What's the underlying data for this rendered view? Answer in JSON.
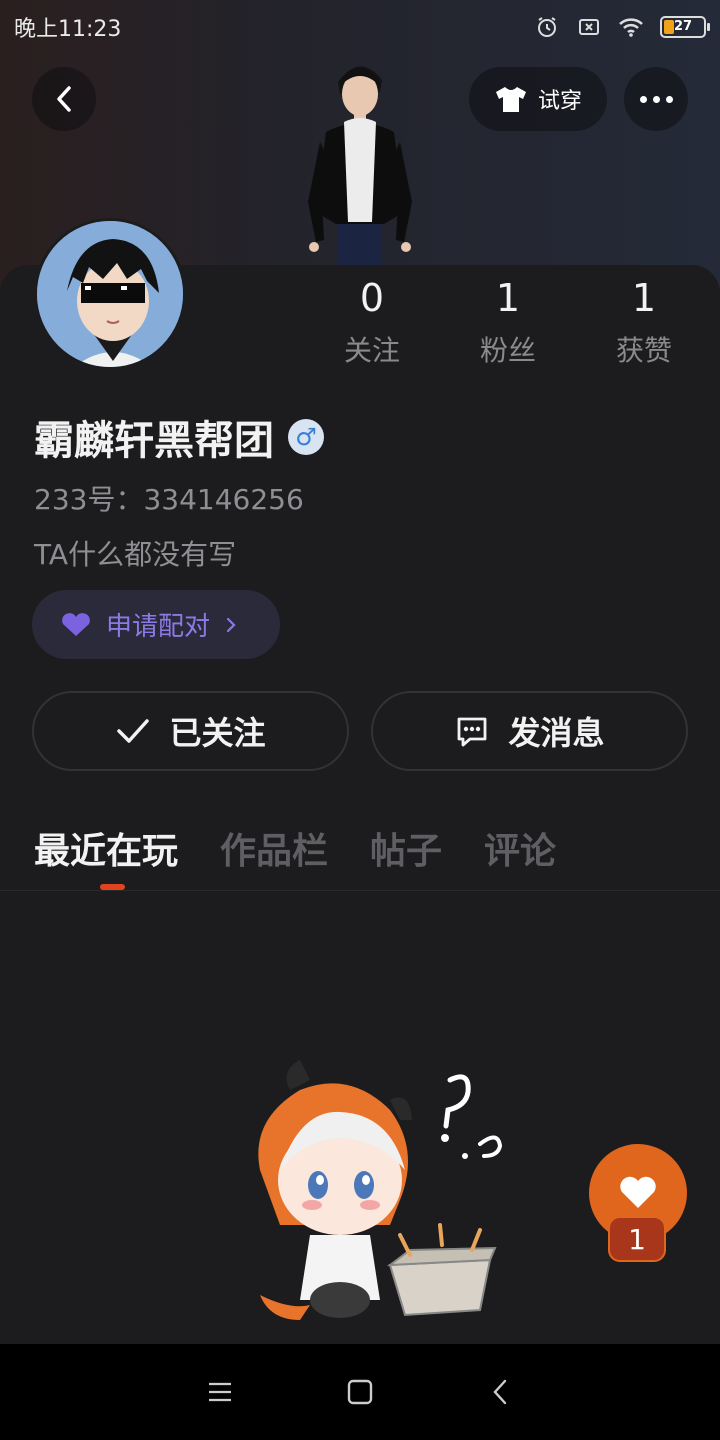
{
  "status_bar": {
    "time": "晚上11:23",
    "battery": "27"
  },
  "header": {
    "tryon_label": "试穿"
  },
  "profile": {
    "name": "霸麟轩黑帮团",
    "gender_symbol": "♂",
    "uid": "233号：334146256",
    "bio": "TA什么都没有写",
    "pair_label": "申请配对"
  },
  "stats": [
    {
      "value": "0",
      "label": "关注"
    },
    {
      "value": "1",
      "label": "粉丝"
    },
    {
      "value": "1",
      "label": "获赞"
    }
  ],
  "actions": {
    "follow_label": "已关注",
    "message_label": "发消息"
  },
  "tabs": [
    {
      "label": "最近在玩"
    },
    {
      "label": "作品栏"
    },
    {
      "label": "帖子"
    },
    {
      "label": "评论"
    }
  ],
  "like": {
    "count": "1"
  },
  "colors": {
    "accent": "#e0441e",
    "like": "#e0661e",
    "pair": "#8c79e6"
  }
}
